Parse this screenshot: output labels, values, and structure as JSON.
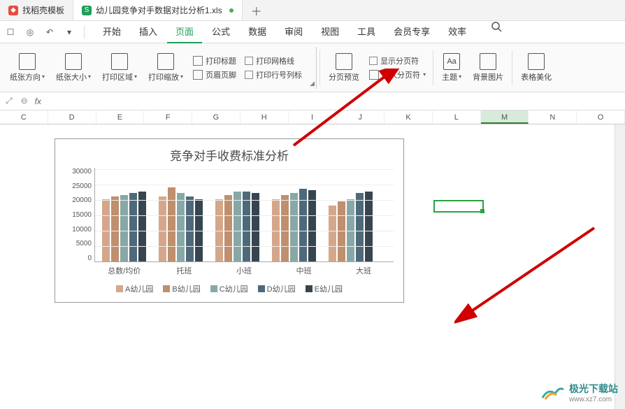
{
  "tabs": {
    "template": "找稻壳模板",
    "file": "幼儿园竞争对手数据对比分析1.xls"
  },
  "menu": {
    "start": "开始",
    "insert": "插入",
    "page": "页面",
    "formula": "公式",
    "data": "数据",
    "review": "审阅",
    "view": "视图",
    "tools": "工具",
    "member": "会员专享",
    "efficiency": "效率"
  },
  "ribbon": {
    "paperDir": "纸张方向",
    "paperSize": "纸张大小",
    "printArea": "打印区域",
    "printScale": "打印缩放",
    "printTitle": "打印标题",
    "headerFooter": "页眉页脚",
    "printGrid": "打印网格线",
    "printRowCol": "打印行号列标",
    "pagePreview": "分页预览",
    "insertBreak": "插入分页符",
    "showBreaks": "显示分页符",
    "theme": "主题",
    "bgImage": "背景图片",
    "tableBeautify": "表格美化"
  },
  "formula_bar": {
    "fx": "fx"
  },
  "columns": [
    "C",
    "D",
    "E",
    "F",
    "G",
    "H",
    "I",
    "J",
    "K",
    "L",
    "M",
    "N",
    "O"
  ],
  "selected_column": "M",
  "chart_data": {
    "type": "bar",
    "title": "竞争对手收费标准分析",
    "xlabel": "",
    "ylabel": "",
    "ylim": [
      0,
      30000
    ],
    "y_ticks": [
      "0",
      "5000",
      "10000",
      "15000",
      "20000",
      "25000",
      "30000"
    ],
    "categories": [
      "总数/均价",
      "托班",
      "小班",
      "中班",
      "大班"
    ],
    "series": [
      {
        "name": "A幼儿园",
        "color": "#d4a78b",
        "values": [
          20000,
          21000,
          20000,
          20000,
          18000
        ]
      },
      {
        "name": "B幼儿园",
        "color": "#c08f6e",
        "values": [
          21000,
          24000,
          21500,
          21500,
          19500
        ]
      },
      {
        "name": "C幼儿园",
        "color": "#88a8a8",
        "values": [
          21500,
          22000,
          22500,
          22000,
          20000
        ]
      },
      {
        "name": "D幼儿园",
        "color": "#4e6a7a",
        "values": [
          22000,
          21000,
          22500,
          23500,
          22000
        ]
      },
      {
        "name": "E幼儿园",
        "color": "#36454f",
        "values": [
          22500,
          20000,
          22000,
          23000,
          22500
        ]
      }
    ]
  },
  "watermark": {
    "name": "极光下载站",
    "url": "www.xz7.com"
  }
}
